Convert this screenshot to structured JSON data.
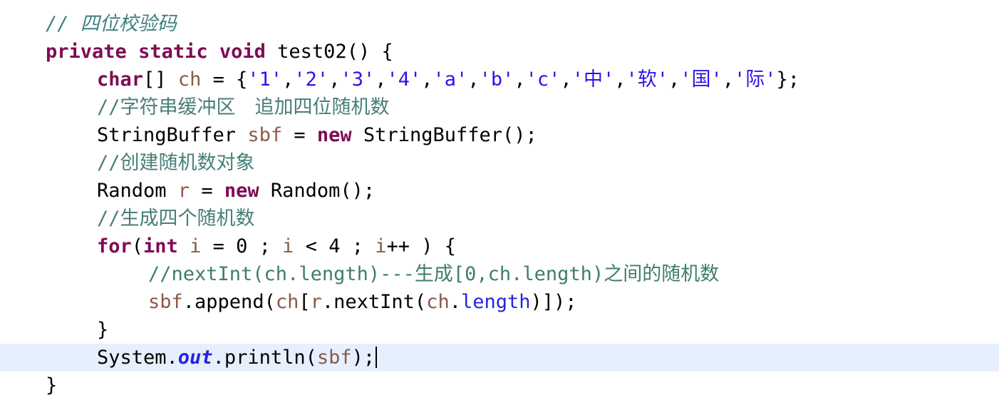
{
  "editor": {
    "language": "java",
    "background": "#ffffff",
    "current_line_highlight_color": "#e6effd",
    "caret_visible": true,
    "colors": {
      "keyword": "#7f0b55",
      "plain_text": "#000000",
      "local_variable": "#8a5a48",
      "field": "#2424e0",
      "static_field": "#2424e0",
      "char_literal": "#2b13e8",
      "comment": "#3f7f63",
      "comment_cjk": "#477f77"
    },
    "lines": [
      {
        "number": 1,
        "indent": 0,
        "highlighted": false,
        "tokens": [
          {
            "text": "// 四位校验码",
            "type": "comment-italic"
          }
        ]
      },
      {
        "number": 2,
        "indent": 0,
        "highlighted": false,
        "tokens": [
          {
            "text": "private",
            "type": "keyword"
          },
          {
            "text": " ",
            "type": "plain"
          },
          {
            "text": "static",
            "type": "keyword"
          },
          {
            "text": " ",
            "type": "plain"
          },
          {
            "text": "void",
            "type": "keyword"
          },
          {
            "text": " test02() {",
            "type": "plain"
          }
        ]
      },
      {
        "number": 3,
        "indent": 1,
        "highlighted": false,
        "tokens": [
          {
            "text": "char",
            "type": "keyword"
          },
          {
            "text": "[] ",
            "type": "plain"
          },
          {
            "text": "ch",
            "type": "variable"
          },
          {
            "text": " = {",
            "type": "plain"
          },
          {
            "text": "'1'",
            "type": "string"
          },
          {
            "text": ",",
            "type": "plain"
          },
          {
            "text": "'2'",
            "type": "string"
          },
          {
            "text": ",",
            "type": "plain"
          },
          {
            "text": "'3'",
            "type": "string"
          },
          {
            "text": ",",
            "type": "plain"
          },
          {
            "text": "'4'",
            "type": "string"
          },
          {
            "text": ",",
            "type": "plain"
          },
          {
            "text": "'a'",
            "type": "string"
          },
          {
            "text": ",",
            "type": "plain"
          },
          {
            "text": "'b'",
            "type": "string"
          },
          {
            "text": ",",
            "type": "plain"
          },
          {
            "text": "'c'",
            "type": "string"
          },
          {
            "text": ",",
            "type": "plain"
          },
          {
            "text": "'中'",
            "type": "string"
          },
          {
            "text": ",",
            "type": "plain"
          },
          {
            "text": "'软'",
            "type": "string"
          },
          {
            "text": ",",
            "type": "plain"
          },
          {
            "text": "'国'",
            "type": "string"
          },
          {
            "text": ",",
            "type": "plain"
          },
          {
            "text": "'际'",
            "type": "string"
          },
          {
            "text": "};",
            "type": "plain"
          }
        ]
      },
      {
        "number": 4,
        "indent": 1,
        "highlighted": false,
        "tokens": [
          {
            "text": "//字符串缓冲区　追加四位随机数",
            "type": "comment-cjk"
          }
        ]
      },
      {
        "number": 5,
        "indent": 1,
        "highlighted": false,
        "tokens": [
          {
            "text": "StringBuffer ",
            "type": "plain"
          },
          {
            "text": "sbf",
            "type": "variable"
          },
          {
            "text": " = ",
            "type": "plain"
          },
          {
            "text": "new",
            "type": "keyword"
          },
          {
            "text": " StringBuffer();",
            "type": "plain"
          }
        ]
      },
      {
        "number": 6,
        "indent": 1,
        "highlighted": false,
        "tokens": [
          {
            "text": "//创建随机数对象",
            "type": "comment-cjk"
          }
        ]
      },
      {
        "number": 7,
        "indent": 1,
        "highlighted": false,
        "tokens": [
          {
            "text": "Random ",
            "type": "plain"
          },
          {
            "text": "r",
            "type": "variable"
          },
          {
            "text": " = ",
            "type": "plain"
          },
          {
            "text": "new",
            "type": "keyword"
          },
          {
            "text": " Random();",
            "type": "plain"
          }
        ]
      },
      {
        "number": 8,
        "indent": 1,
        "highlighted": false,
        "tokens": [
          {
            "text": "//生成四个随机数",
            "type": "comment-cjk"
          }
        ]
      },
      {
        "number": 9,
        "indent": 1,
        "highlighted": false,
        "tokens": [
          {
            "text": "for",
            "type": "keyword"
          },
          {
            "text": "(",
            "type": "plain"
          },
          {
            "text": "int",
            "type": "keyword"
          },
          {
            "text": " ",
            "type": "plain"
          },
          {
            "text": "i",
            "type": "variable"
          },
          {
            "text": " = 0 ; ",
            "type": "plain"
          },
          {
            "text": "i",
            "type": "variable"
          },
          {
            "text": " < 4 ; ",
            "type": "plain"
          },
          {
            "text": "i",
            "type": "variable"
          },
          {
            "text": "++ ) {",
            "type": "plain"
          }
        ]
      },
      {
        "number": 10,
        "indent": 2,
        "highlighted": false,
        "tokens": [
          {
            "text": "//nextInt(ch.length)---生成[0,ch.length)之间的随机数",
            "type": "comment"
          }
        ]
      },
      {
        "number": 11,
        "indent": 2,
        "highlighted": false,
        "tokens": [
          {
            "text": "sbf",
            "type": "variable"
          },
          {
            "text": ".append(",
            "type": "plain"
          },
          {
            "text": "ch",
            "type": "variable"
          },
          {
            "text": "[",
            "type": "plain"
          },
          {
            "text": "r",
            "type": "variable"
          },
          {
            "text": ".nextInt(",
            "type": "plain"
          },
          {
            "text": "ch",
            "type": "variable"
          },
          {
            "text": ".",
            "type": "plain"
          },
          {
            "text": "length",
            "type": "field"
          },
          {
            "text": ")]);",
            "type": "plain"
          }
        ]
      },
      {
        "number": 12,
        "indent": 1,
        "highlighted": false,
        "tokens": [
          {
            "text": "}",
            "type": "plain"
          }
        ]
      },
      {
        "number": 13,
        "indent": 1,
        "highlighted": true,
        "caret_after": true,
        "tokens": [
          {
            "text": "System.",
            "type": "plain"
          },
          {
            "text": "out",
            "type": "static-field"
          },
          {
            "text": ".println(",
            "type": "plain"
          },
          {
            "text": "sbf",
            "type": "variable"
          },
          {
            "text": ");",
            "type": "plain"
          }
        ]
      },
      {
        "number": 14,
        "indent": 0,
        "highlighted": false,
        "tokens": [
          {
            "text": "}",
            "type": "plain"
          }
        ]
      }
    ]
  }
}
